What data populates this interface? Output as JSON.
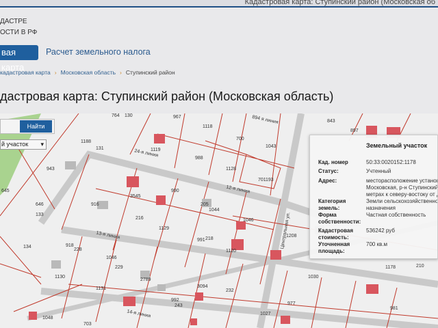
{
  "header": {
    "top_title": "Кадастровая карта: Ступинский район (Московская об",
    "logo_line1": "ДАСТРЕ",
    "logo_line2": "ОСТИ В РФ"
  },
  "nav": {
    "active_tab": "вая карта",
    "tab2": "Расчет земельного налога"
  },
  "breadcrumb": [
    "кадастровая карта",
    "Московская область",
    "Ступинский район"
  ],
  "page_title": "дастровая карта: Ступинский район (Московская область)",
  "search": {
    "button": "Найти",
    "select_value": "й участок"
  },
  "map_labels": [
    "764",
    "130",
    "1188",
    "131",
    "967",
    "1118",
    "894 я линия",
    "843",
    "897",
    "943",
    "1119",
    "988",
    "700",
    "1043",
    "645",
    "646",
    "133",
    "1128",
    "701",
    "193",
    "12-я линия",
    "916",
    "3545",
    "990",
    "205",
    "1044",
    "216",
    "1129",
    "1046",
    "134",
    "918",
    "228",
    "13-я линия",
    "1046",
    "991",
    "218",
    "1120",
    "1208",
    "1130",
    "229",
    "2789",
    "3094",
    "232",
    "1131",
    "1027",
    "977",
    "1048",
    "703",
    "14-я линия",
    "992",
    "243",
    "981",
    "1030",
    "24-я линия",
    "Центральная ул.",
    "1178",
    "210"
  ],
  "popup": {
    "title": "Земельный участок",
    "rows": [
      {
        "k": "Кад. номер",
        "v": "50:33:0020152:1178"
      },
      {
        "k": "Статус:",
        "v": "Учтенный"
      },
      {
        "k": "Адрес:",
        "v": "месторасположение установ\nМосковская, р-н Ступинский,\nметрах к северу-востоку от д"
      },
      {
        "k": "Категория земель:",
        "v": "Земли сельскохозяйственно\nназначения"
      },
      {
        "k": "Форма собственности:",
        "v": "Частная собственность"
      },
      {
        "k": "Кадастровая стоимость:",
        "v": "536242 руб"
      },
      {
        "k": "Уточненная площадь:",
        "v": "700 кв.м"
      }
    ]
  }
}
